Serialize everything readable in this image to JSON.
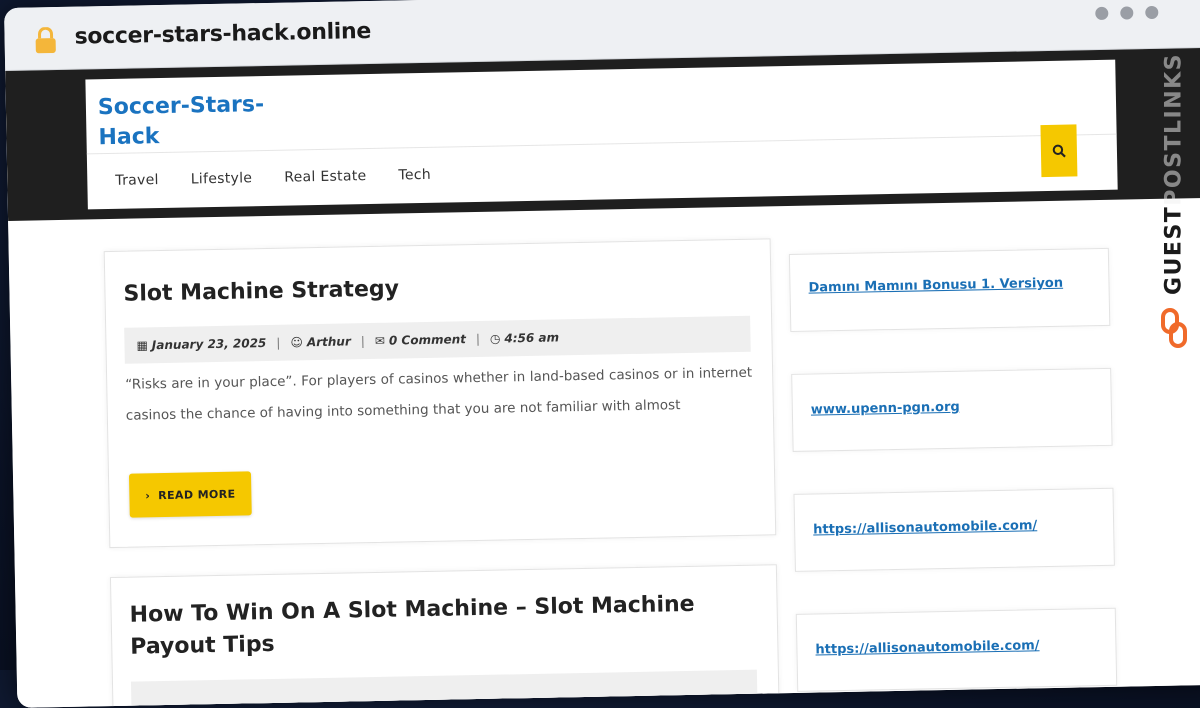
{
  "browser": {
    "url": "soccer-stars-hack.online"
  },
  "site": {
    "title": "Soccer-Stars-Hack",
    "nav": [
      "Travel",
      "Lifestyle",
      "Real Estate",
      "Tech"
    ]
  },
  "posts": [
    {
      "title": "Slot Machine Strategy",
      "date": "January 23, 2025",
      "author": "Arthur",
      "comments": "0 Comment",
      "time": "4:56 am",
      "excerpt": "“Risks are in your place”. For players of casinos whether in land-based casinos or in internet casinos the chance of having into something that you are not familiar with almost",
      "read_more": "READ MORE"
    },
    {
      "title": "How To Win On A Slot Machine – Slot Machine Payout Tips"
    }
  ],
  "sidebar": {
    "links": [
      "Damını Mamını Bonusu 1. Versiyon",
      "www.upenn-pgn.org",
      "https://allisonautomobile.com/",
      "https://allisonautomobile.com/"
    ]
  },
  "branding": {
    "text_part1": "GUEST",
    "text_part2": "POSTLINKS"
  },
  "colors": {
    "accent": "#f5c800",
    "link": "#1a6fb5",
    "title": "#1a73c0",
    "brand_orange": "#f06a2a"
  }
}
